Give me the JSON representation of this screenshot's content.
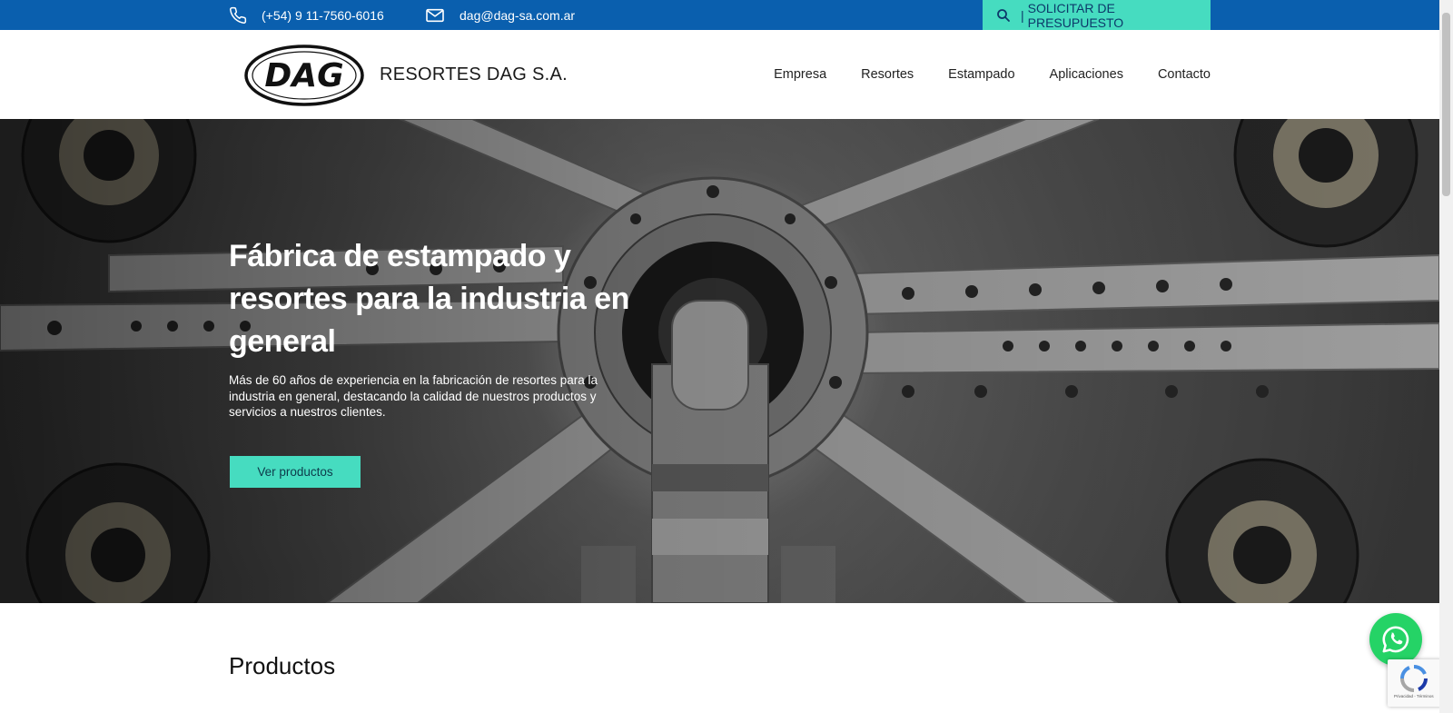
{
  "topbar": {
    "phone": "(+54) 9 11-7560-6016",
    "email": "dag@dag-sa.com.ar",
    "quote_separator": "|",
    "quote_label": "SOLICITAR DE PRESUPUESTO"
  },
  "header": {
    "logo_text": "DAG",
    "brand": "RESORTES DAG S.A.",
    "nav": [
      {
        "label": "Empresa"
      },
      {
        "label": "Resortes"
      },
      {
        "label": "Estampado"
      },
      {
        "label": "Aplicaciones"
      },
      {
        "label": "Contacto"
      }
    ]
  },
  "hero": {
    "title": "Fábrica de estampado y resortes para la industria en general",
    "subtitle": "Más de 60 años de experiencia en la fabricación de resortes para la industria en general, destacando la calidad de nuestros productos y servicios a nuestros clientes.",
    "cta_label": "Ver productos"
  },
  "products": {
    "title": "Productos"
  },
  "recaptcha": {
    "text": "Privacidad - Términos"
  },
  "colors": {
    "topbar_bg": "#0a5fae",
    "accent": "#46dcc0",
    "whatsapp": "#25d366"
  },
  "icons": {
    "phone": "phone-icon",
    "email": "mail-icon",
    "search": "search-icon",
    "whatsapp": "whatsapp-icon",
    "recaptcha": "recaptcha-icon"
  }
}
